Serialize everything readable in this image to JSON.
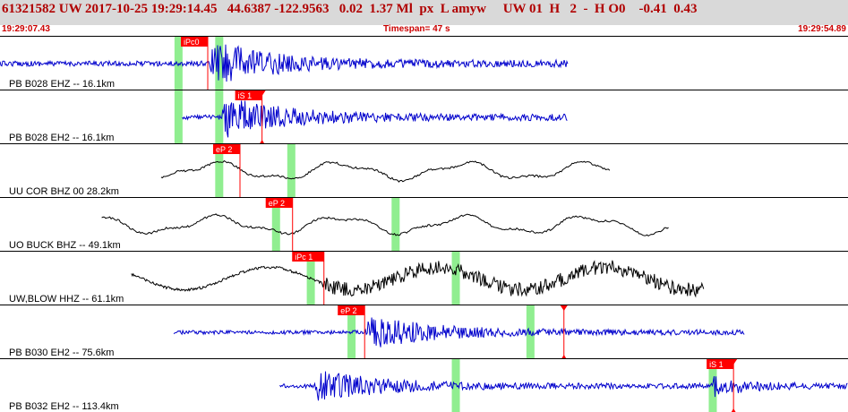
{
  "header": {
    "title": "61321582 UW 2017-10-25 19:29:14.45   44.6387 -122.9563   0.02  1.37 Ml  px  L amyw     UW 01  H   2  -  H O0    -0.41  0.43"
  },
  "subheader": {
    "start_time": "19:29:07.43",
    "timespan": "Timespan=  47 s",
    "end_time": "19:29:54.89"
  },
  "colors": {
    "header_bg": "#d9d9d9",
    "title_red": "#b00000",
    "trace_blue": "#0000cc",
    "trace_black": "#000000",
    "pick_red": "#ff0000",
    "window_green": "#90ee90"
  },
  "panels": [
    {
      "label": "PB B028 EHZ -- 16.1km",
      "trace_color": "blue",
      "trace_start": 0.0,
      "trace_end": 0.67,
      "onset": 0.245,
      "style": "quake",
      "amp": 0.6,
      "green": [
        0.21,
        0.258
      ],
      "picks": [
        {
          "pos": 0.245,
          "tag": "iPc0",
          "marker": false
        }
      ]
    },
    {
      "label": "PB B028 EH2 -- 16.1km",
      "trace_color": "blue",
      "trace_start": 0.215,
      "trace_end": 0.67,
      "onset": 0.26,
      "style": "quake",
      "amp": 0.55,
      "green": [
        0.21,
        0.258
      ],
      "picks": [
        {
          "pos": 0.309,
          "tag": "iS 1",
          "marker": true
        }
      ]
    },
    {
      "label": "UU COR BHZ 00 28.2km",
      "trace_color": "black",
      "trace_start": 0.19,
      "trace_end": 0.72,
      "onset": 0.3,
      "style": "wave",
      "amp": 0.6,
      "green": [
        0.258,
        0.343
      ],
      "picks": [
        {
          "pos": 0.283,
          "tag": "eP 2",
          "marker": false
        }
      ]
    },
    {
      "label": "UO BUCK BHZ -- 49.1km",
      "trace_color": "black",
      "trace_start": 0.12,
      "trace_end": 0.79,
      "onset": 0.35,
      "style": "wave",
      "amp": 0.6,
      "green": [
        0.325,
        0.466
      ],
      "picks": [
        {
          "pos": 0.345,
          "tag": "eP 2",
          "marker": false
        }
      ]
    },
    {
      "label": "UW,BLOW HHZ -- 61.1km",
      "trace_color": "black",
      "trace_start": 0.155,
      "trace_end": 0.83,
      "onset": 0.38,
      "style": "blow",
      "amp": 0.7,
      "green": [
        0.366,
        0.537
      ],
      "picks": [
        {
          "pos": 0.382,
          "tag": "iPc 1",
          "marker": false
        }
      ]
    },
    {
      "label": "PB B030 EH2 -- 75.6km",
      "trace_color": "blue",
      "trace_start": 0.205,
      "trace_end": 0.878,
      "onset": 0.43,
      "style": "quake",
      "amp": 0.45,
      "green": [
        0.414,
        0.625
      ],
      "picks": [
        {
          "pos": 0.43,
          "tag": "eP 2",
          "marker": false
        },
        {
          "pos": 0.665,
          "tag": "",
          "marker": true
        }
      ]
    },
    {
      "label": "PB B032 EH2 -- 113.4km",
      "trace_color": "blue",
      "trace_start": 0.33,
      "trace_end": 1.0,
      "onset": 0.37,
      "style": "quake2",
      "amp": 0.45,
      "green": [
        0.537,
        0.84
      ],
      "picks": [
        {
          "pos": 0.865,
          "tag": "iS 1",
          "marker": true
        }
      ]
    }
  ]
}
